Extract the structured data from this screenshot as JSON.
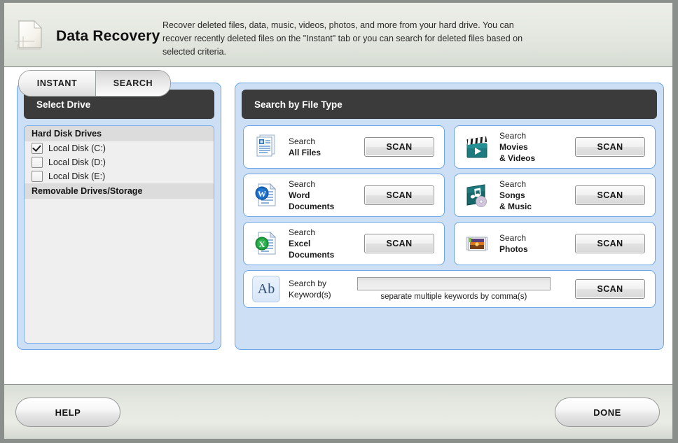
{
  "window": {
    "app_title": "Data Recovery",
    "app_icon": "document-icon",
    "description": "Recover deleted files, data, music, videos, photos, and more from your hard drive. You can recover recently deleted files on the \"Instant\" tab or you can search for deleted files based on selected criteria."
  },
  "tabs": [
    {
      "label": "INSTANT",
      "active": false
    },
    {
      "label": "SEARCH",
      "active": true
    }
  ],
  "drive_panel": {
    "title": "Select Drive",
    "groups": [
      {
        "header": "Hard Disk Drives",
        "drives": [
          {
            "label": "Local Disk (C:)",
            "checked": true
          },
          {
            "label": "Local Disk (D:)",
            "checked": false
          },
          {
            "label": "Local Disk (E:)",
            "checked": false
          }
        ]
      },
      {
        "header": "Removable Drives/Storage",
        "drives": []
      }
    ]
  },
  "filetype_panel": {
    "title": "Search by File Type",
    "scan_label": "SCAN",
    "cards": [
      {
        "prefix": "Search",
        "line2": "All Files",
        "line3": "",
        "icon": "all-files-icon"
      },
      {
        "prefix": "Search",
        "line2": "Word",
        "line3": "Documents",
        "icon": "word-document-icon"
      },
      {
        "prefix": "Search",
        "line2": "Excel",
        "line3": "Documents",
        "icon": "excel-document-icon"
      },
      {
        "prefix": "Search",
        "line2": "Movies",
        "line3": "& Videos",
        "icon": "movies-videos-icon"
      },
      {
        "prefix": "Search",
        "line2": "Songs",
        "line3": "& Music",
        "icon": "songs-music-icon"
      },
      {
        "prefix": "Search",
        "line2": "Photos",
        "line3": "",
        "icon": "photos-icon"
      }
    ],
    "keyword_row": {
      "icon_text": "Ab",
      "icon": "keyword-icon",
      "prefix": "Search by",
      "line2": "Keyword(s)",
      "input_value": "",
      "input_placeholder": "",
      "hint": "separate multiple keywords by comma(s)",
      "scan_label": "SCAN"
    }
  },
  "footer": {
    "help_label": "HELP",
    "done_label": "DONE"
  },
  "colors": {
    "panel_fill": "#ccdff5",
    "panel_border": "#6ba6e8",
    "panel_title_bg": "#3b3b3b",
    "header_bg": "#e6e9e2",
    "frame": "#8a8f8c"
  }
}
